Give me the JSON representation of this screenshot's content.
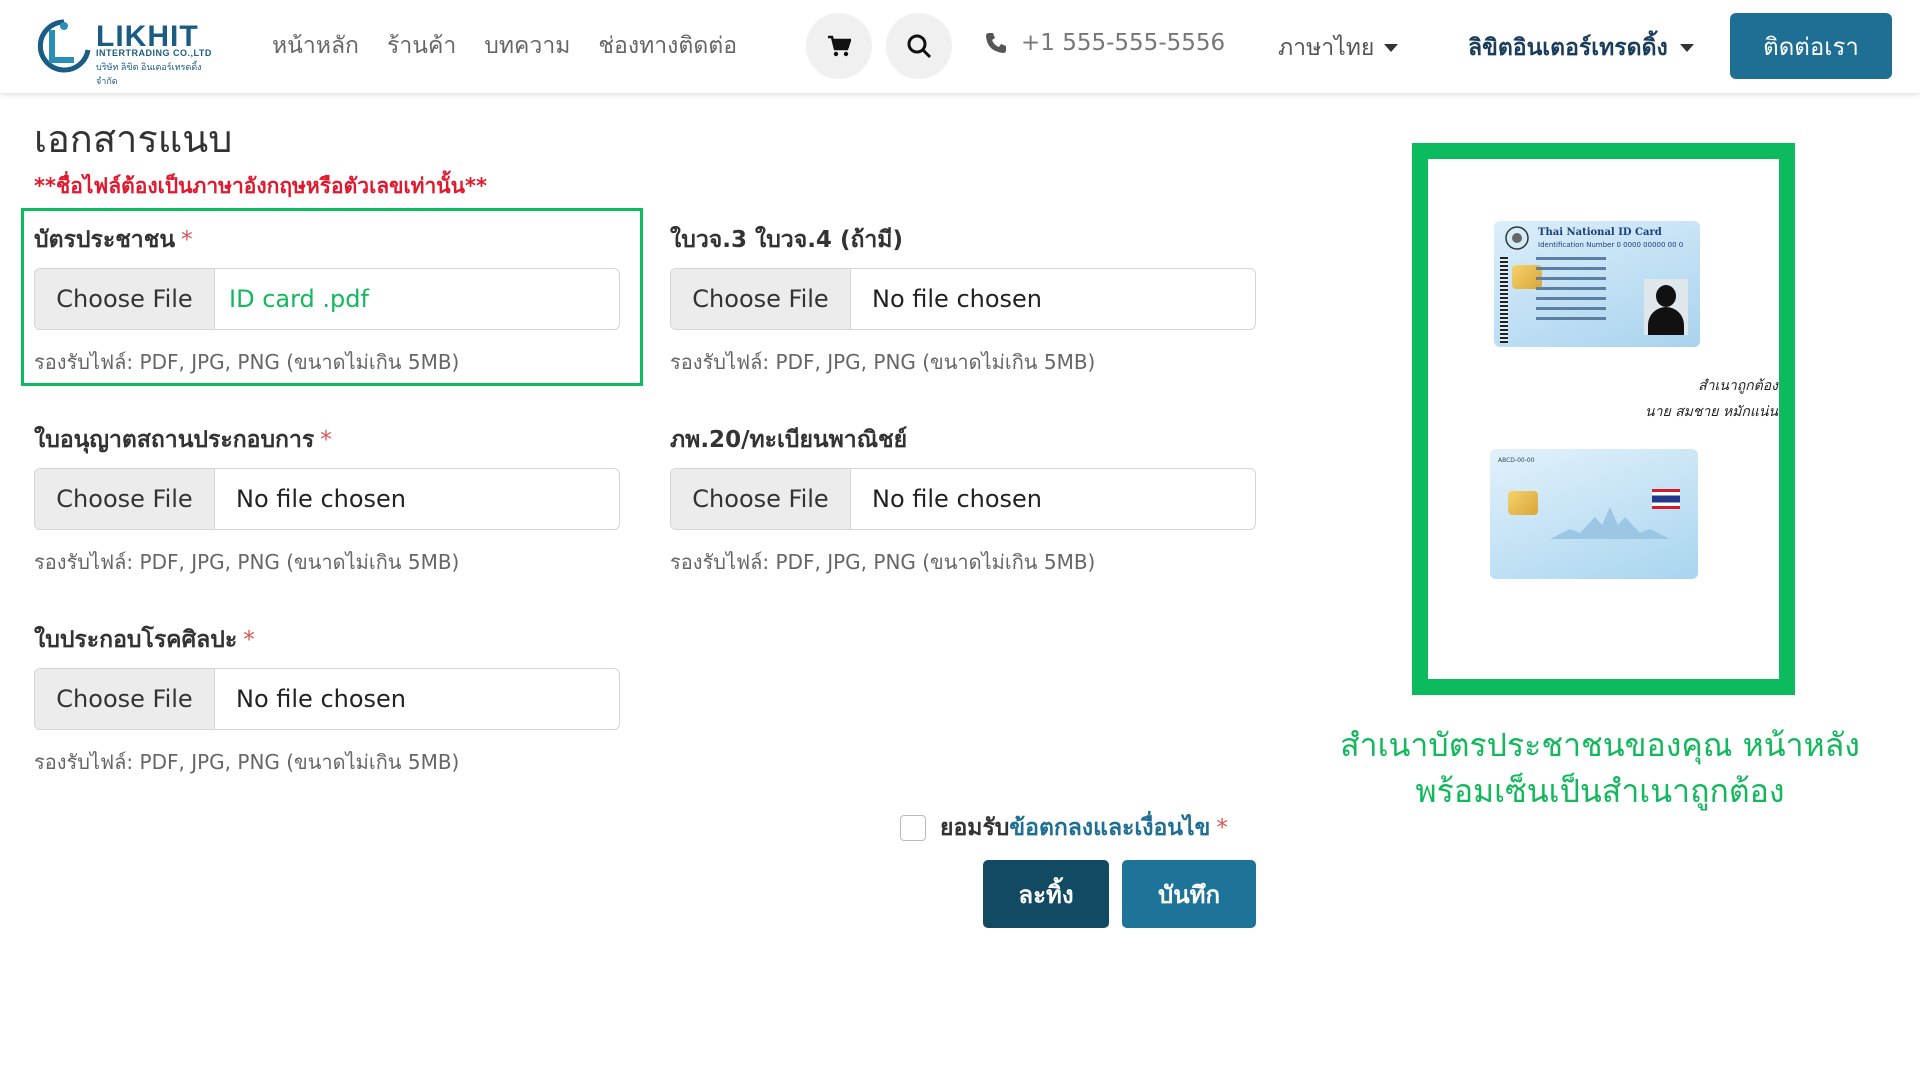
{
  "header": {
    "logo_text": "LIKHIT",
    "logo_sub": "INTERTRADING CO.,LTD",
    "logo_sub_thai": "บริษัท ลิขิต อินเตอร์เทรดดิ้ง จำกัด",
    "nav": [
      "หน้าหลัก",
      "ร้านค้า",
      "บทความ",
      "ช่องทางติดต่อ"
    ],
    "phone": "+1 555-555-5556",
    "language": "ภาษาไทย",
    "company": "ลิขิตอินเตอร์เทรดดิ้ง",
    "contact_button": "ติดต่อเรา"
  },
  "form": {
    "title": "เอกสารแนบ",
    "warning": "**ชื่อไฟล์ต้องเป็นภาษาอังกฤษหรือตัวเลขเท่านั้น**",
    "choose_label": "Choose File",
    "hint": "รองรับไฟล์: PDF, JPG, PNG (ขนาดไม่เกิน 5MB)",
    "fields": [
      {
        "label": "บัตรประชาชน",
        "required": "*",
        "file": "ID card .pdf"
      },
      {
        "label": "ใบวจ.3 ใบวจ.4 (ถ้ามี)",
        "required": "",
        "file": "No file chosen"
      },
      {
        "label": "ใบอนุญาตสถานประกอบการ",
        "required": "*",
        "file": "No file chosen"
      },
      {
        "label": "ภพ.20/ทะเบียนพาณิชย์",
        "required": "",
        "file": "No file chosen"
      },
      {
        "label": "ใบประกอบโรคศิลปะ",
        "required": "*",
        "file": "No file chosen"
      }
    ],
    "agree_prefix": "ยอมรับ",
    "agree_link": "ข้อตกลงและเงื่อนไข",
    "agree_required": "*",
    "discard_button": "ละทิ้ง",
    "save_button": "บันทึก"
  },
  "example": {
    "card_title": "Thai National ID Card",
    "card_number": "Identification Number  0 0000 00000 00 0",
    "sign_line1": "สำเนาถูกต้อง",
    "sign_line2": "นาย สมชาย หมักแน่น",
    "back_code": "ABCD-00-00",
    "caption_line1": "สำเนาบัตรประชาชนของคุณ หน้าหลัง",
    "caption_line2": "พร้อมเซ็นเป็นสำเนาถูกต้อง"
  },
  "colors": {
    "primary": "#1e6f93",
    "dark_primary": "#114a62",
    "highlight_green": "#0dbb5f",
    "warning_red": "#e0192e"
  }
}
